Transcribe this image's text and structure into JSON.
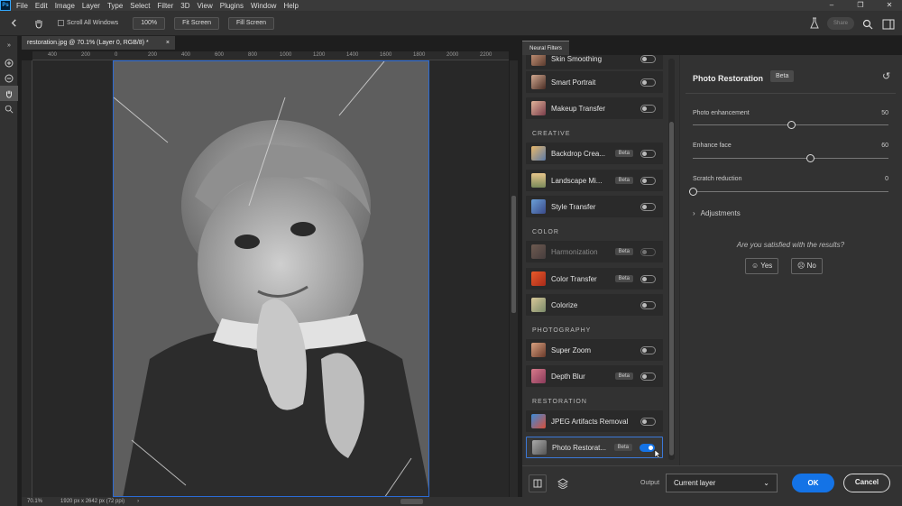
{
  "menubar": {
    "logo": "Ps",
    "items": [
      "File",
      "Edit",
      "Image",
      "Layer",
      "Type",
      "Select",
      "Filter",
      "3D",
      "View",
      "Plugins",
      "Window",
      "Help"
    ],
    "window_controls": [
      "–",
      "❐",
      "✕"
    ]
  },
  "optionsbar": {
    "scroll_all_windows": "Scroll All Windows",
    "zoom_100": "100%",
    "fit_screen": "Fit Screen",
    "fill_screen": "Fill Screen",
    "share": "Share"
  },
  "document": {
    "tab_title": "restoration.jpg @ 70.1% (Layer 0, RGB/8) *",
    "close": "×",
    "ruler_ticks": [
      "400",
      "200",
      "0",
      "200",
      "400",
      "600",
      "800",
      "1000",
      "1200",
      "1400",
      "1600",
      "1800",
      "2000",
      "2200"
    ],
    "zoom": "70.1%",
    "dimensions": "1920 px x 2642 px (72 ppi)"
  },
  "neural_filters": {
    "tab_label": "Neural Filters",
    "partial_item": "Skin Smoothing",
    "items_portraits": [
      {
        "label": "Smart Portrait",
        "beta": "",
        "on": false,
        "dim": false
      },
      {
        "label": "Makeup Transfer",
        "beta": "",
        "on": false,
        "dim": false
      }
    ],
    "cat_creative": "CREATIVE",
    "items_creative": [
      {
        "label": "Backdrop Crea...",
        "beta": "Beta",
        "on": false,
        "dim": false
      },
      {
        "label": "Landscape Mi...",
        "beta": "Beta",
        "on": false,
        "dim": false
      },
      {
        "label": "Style Transfer",
        "beta": "",
        "on": false,
        "dim": false
      }
    ],
    "cat_color": "COLOR",
    "items_color": [
      {
        "label": "Harmonization",
        "beta": "Beta",
        "on": false,
        "dim": true
      },
      {
        "label": "Color Transfer",
        "beta": "Beta",
        "on": false,
        "dim": false
      },
      {
        "label": "Colorize",
        "beta": "",
        "on": false,
        "dim": false
      }
    ],
    "cat_photography": "PHOTOGRAPHY",
    "items_photography": [
      {
        "label": "Super Zoom",
        "beta": "",
        "on": false,
        "dim": false
      },
      {
        "label": "Depth Blur",
        "beta": "Beta",
        "on": false,
        "dim": false
      }
    ],
    "cat_restoration": "RESTORATION",
    "items_restoration": [
      {
        "label": "JPEG Artifacts Removal",
        "beta": "",
        "on": false,
        "dim": false
      },
      {
        "label": "Photo Restorat...",
        "beta": "Beta",
        "on": true,
        "dim": false
      }
    ]
  },
  "photo_restoration": {
    "title": "Photo Restoration",
    "beta": "Beta",
    "reset_icon": "↺",
    "sliders": [
      {
        "label": "Photo enhancement",
        "value": "50",
        "fraction": 0.5
      },
      {
        "label": "Enhance face",
        "value": "60",
        "fraction": 0.6
      },
      {
        "label": "Scratch reduction",
        "value": "0",
        "fraction": 0.0
      }
    ],
    "adjustments": "Adjustments",
    "question": "Are you satisfied with the results?",
    "yes": "Yes",
    "no": "No"
  },
  "bottom": {
    "output_label": "Output",
    "output_value": "Current layer",
    "ok": "OK",
    "cancel": "Cancel"
  }
}
